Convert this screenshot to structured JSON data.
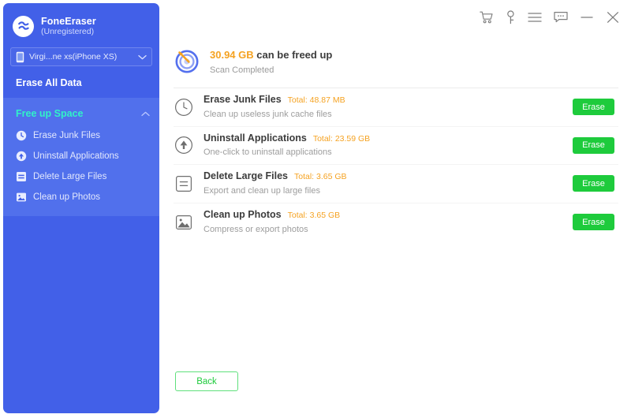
{
  "app": {
    "name": "FoneEraser",
    "registration": "(Unregistered)",
    "logo_icon": "foneeraser-logo-icon"
  },
  "sidebar": {
    "device": {
      "icon": "phone-icon",
      "label": "Virgi...ne xs(iPhone XS)",
      "chevron_icon": "chevron-down-icon"
    },
    "erase_all_data_label": "Erase All Data",
    "section": {
      "title": "Free up Space",
      "chevron_icon": "chevron-up-icon",
      "items": [
        {
          "label": "Erase Junk Files",
          "icon": "clock-icon"
        },
        {
          "label": "Uninstall Applications",
          "icon": "arrow-up-circle-icon"
        },
        {
          "label": "Delete Large Files",
          "icon": "file-lines-icon"
        },
        {
          "label": "Clean up Photos",
          "icon": "photo-icon"
        }
      ]
    }
  },
  "titlebar": {
    "icons": [
      {
        "name": "cart-icon",
        "title": "Buy"
      },
      {
        "name": "key-icon",
        "title": "Register"
      },
      {
        "name": "menu-icon",
        "title": "Menu"
      },
      {
        "name": "feedback-icon",
        "title": "Feedback"
      },
      {
        "name": "minimize-icon",
        "title": "Minimize"
      },
      {
        "name": "close-icon",
        "title": "Close"
      }
    ]
  },
  "main": {
    "scan": {
      "icon": "scan-target-icon",
      "amount": "30.94 GB",
      "title_rest": " can be freed up",
      "status": "Scan Completed"
    },
    "rows": [
      {
        "icon": "clock-icon",
        "title": "Erase Junk Files",
        "total": "Total: 48.87 MB",
        "desc": "Clean up useless junk cache files",
        "action": "Erase"
      },
      {
        "icon": "arrow-up-circle-icon",
        "title": "Uninstall Applications",
        "total": "Total: 23.59 GB",
        "desc": "One-click to uninstall applications",
        "action": "Erase"
      },
      {
        "icon": "file-lines-icon",
        "title": "Delete Large Files",
        "total": "Total: 3.65 GB",
        "desc": "Export and clean up large files",
        "action": "Erase"
      },
      {
        "icon": "photo-icon",
        "title": "Clean up Photos",
        "total": "Total: 3.65 GB",
        "desc": "Compress or export photos",
        "action": "Erase"
      }
    ],
    "back_label": "Back"
  },
  "colors": {
    "sidebar_blue": "#4260e8",
    "sidebar_section_blue": "#5170ec",
    "accent_green": "#1ecb3c",
    "highlight_cyan": "#31f2c8",
    "amount_orange": "#f5a221"
  }
}
